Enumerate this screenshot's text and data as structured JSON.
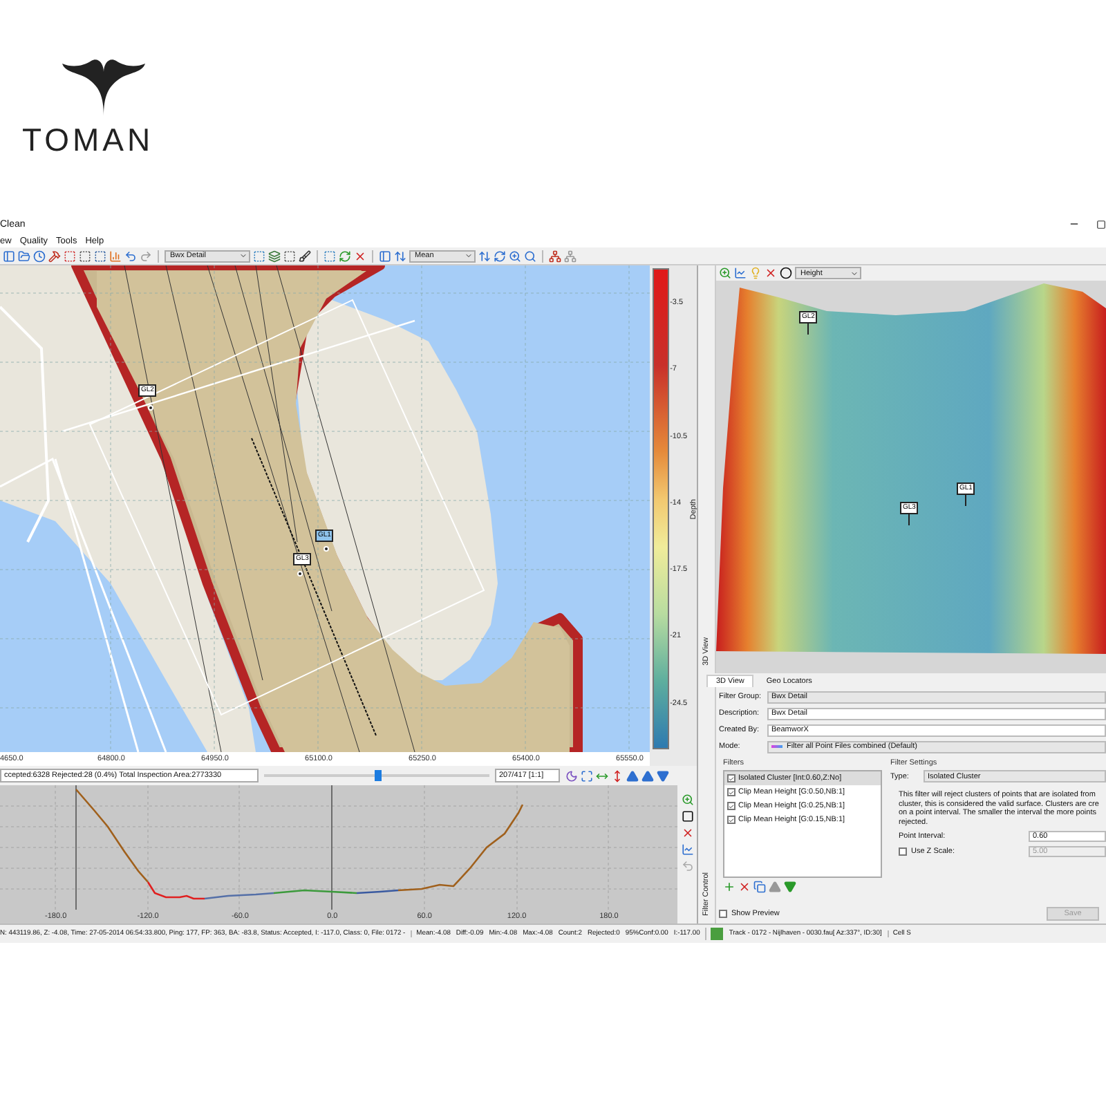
{
  "logo": {
    "text": "TOMAN"
  },
  "window": {
    "title": "Clean"
  },
  "menu": [
    {
      "label": "ew"
    },
    {
      "label": "Quality"
    },
    {
      "label": "Tools"
    },
    {
      "label": "Help"
    }
  ],
  "toolbar": {
    "filter_group": "Bwx Detail",
    "statistic": "Mean"
  },
  "map": {
    "markers": [
      {
        "label": "GL2",
        "selected": false
      },
      {
        "label": "GL1",
        "selected": true
      },
      {
        "label": "GL3",
        "selected": false
      }
    ],
    "x_ticks": [
      "4650.0",
      "64800.0",
      "64950.0",
      "65100.0",
      "65250.0",
      "65400.0",
      "65550.0"
    ],
    "scale_label": "Depth",
    "scale_ticks": [
      "-3.5",
      "-7",
      "-10.5",
      "-14",
      "-17.5",
      "-21",
      "-24.5"
    ]
  },
  "navigator": {
    "summary": "ccepted:6328 Rejected:28 (0.4%) Total Inspection Area:2773330",
    "level": 0.5,
    "position": "207/417 [1:1]"
  },
  "profile": {
    "x_ticks": [
      "-180.0",
      "-120.0",
      "-60.0",
      "0.0",
      "60.0",
      "120.0",
      "180.0"
    ]
  },
  "view_3d": {
    "mode": "Height",
    "side_label": "3D View",
    "markers": [
      {
        "label": "GL2"
      },
      {
        "label": "GL1"
      },
      {
        "label": "GL3"
      }
    ]
  },
  "dock_tabs": [
    {
      "label": "3D View",
      "selected": true
    },
    {
      "label": "Geo Locators",
      "selected": false
    }
  ],
  "filter_control": {
    "side_label": "Filter Control",
    "fields": [
      {
        "label": "Filter Group:",
        "value": "Bwx Detail",
        "kind": "dropdown"
      },
      {
        "label": "Description:",
        "value": "Bwx Detail",
        "kind": "text"
      },
      {
        "label": "Created By:",
        "value": "BeamworX",
        "kind": "text"
      },
      {
        "label": "Mode:",
        "value": "Filter all Point Files combined (Default)",
        "kind": "mode"
      }
    ],
    "filters_title": "Filters",
    "filters": [
      {
        "label": "Isolated Cluster [Int:0.60,Z:No]",
        "checked": true,
        "selected": true
      },
      {
        "label": "Clip Mean Height [G:0.50,NB:1]",
        "checked": true,
        "selected": false
      },
      {
        "label": "Clip Mean Height [G:0.25,NB:1]",
        "checked": true,
        "selected": false
      },
      {
        "label": "Clip Mean Height [G:0.15,NB:1]",
        "checked": true,
        "selected": false
      }
    ],
    "settings": {
      "title": "Filter Settings",
      "type_label": "Type:",
      "type_value": "Isolated Cluster",
      "description": [
        "This filter will reject clusters of points that are isolated from",
        "cluster, this is considered the valid surface. Clusters are cre",
        "on a point interval. The smaller the interval the more points",
        "rejected."
      ],
      "point_interval": {
        "label": "Point Interval:",
        "value": "0.60"
      },
      "use_z_scale": {
        "label": "Use Z Scale:",
        "checked": false,
        "value": "5.00"
      }
    },
    "show_preview": {
      "label": "Show Preview",
      "checked": false
    },
    "save": {
      "label": "Save",
      "disabled": true
    }
  },
  "status_bar": {
    "position": "N: 443119.86, Z: -4.08, Time: 27-05-2014 06:54:33.800, Ping: 177, FP: 363, BA: -83.8, Status: Accepted, I: -117.0, Class: 0, File: 0172 -",
    "stats": [
      "Mean:-4.08",
      "Diff:-0.09",
      "Min:-4.08",
      "Max:-4.08",
      "Count:2",
      "Rejected:0",
      "95%Conf:0.00",
      "I:-117.00"
    ],
    "track": "Track - 0172 - Nijlhaven - 0030.fau[ Az:337°, ID:30]",
    "cell": "Cell S"
  }
}
